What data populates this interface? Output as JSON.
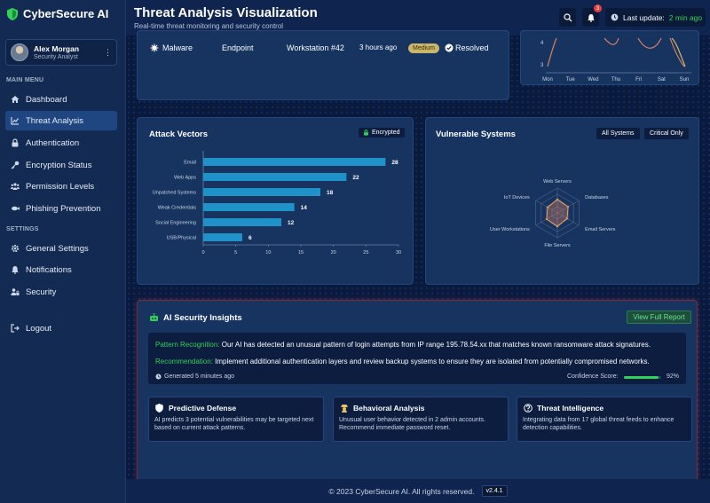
{
  "brand": {
    "name": "CyberSecure AI",
    "icon": "shield-icon"
  },
  "user": {
    "name": "Alex Morgan",
    "role": "Security Analyst"
  },
  "sidebar": {
    "main_menu_title": "MAIN MENU",
    "main_items": [
      {
        "label": "Dashboard",
        "icon": "home-icon"
      },
      {
        "label": "Threat Analysis",
        "icon": "chart-line-icon",
        "active": true
      },
      {
        "label": "Authentication",
        "icon": "lock-icon"
      },
      {
        "label": "Encryption Status",
        "icon": "key-icon"
      },
      {
        "label": "Permission Levels",
        "icon": "users-icon"
      },
      {
        "label": "Phishing Prevention",
        "icon": "fish-icon"
      }
    ],
    "settings_title": "SETTINGS",
    "settings_items": [
      {
        "label": "General Settings",
        "icon": "gear-icon"
      },
      {
        "label": "Notifications",
        "icon": "bell-icon"
      },
      {
        "label": "Security",
        "icon": "user-lock-icon"
      }
    ],
    "logout_label": "Logout"
  },
  "header": {
    "title": "Threat Analysis Visualization",
    "subtitle": "Real-time threat monitoring and security control",
    "notification_count": "3",
    "last_update_label": "Last update:",
    "last_update_value": "2 min ago"
  },
  "threat_row": {
    "type": "Malware",
    "vector": "Endpoint",
    "system": "Workstation #42",
    "time": "3 hours ago",
    "severity": "Medium",
    "status": "Resolved"
  },
  "weekly_chart": {
    "y_tick_top": "4",
    "y_tick_bottom": "3",
    "days": [
      "Mon",
      "Tue",
      "Wed",
      "Thu",
      "Fri",
      "Sat",
      "Sun"
    ]
  },
  "attack_vectors": {
    "title": "Attack Vectors",
    "badge": "Encrypted"
  },
  "vulnerable": {
    "title": "Vulnerable Systems",
    "btn_all": "All Systems",
    "btn_critical": "Critical Only",
    "axes": [
      "Web Servers",
      "Databases",
      "Email Servers",
      "File Servers",
      "User Workstations",
      "IoT Devices"
    ]
  },
  "chart_data": [
    {
      "type": "bar",
      "title": "Attack Vectors",
      "orientation": "horizontal",
      "categories": [
        "Email",
        "Web Apps",
        "Unpatched Systems",
        "Weak Credentials",
        "Social Engineering",
        "USB/Physical"
      ],
      "values": [
        28,
        22,
        18,
        14,
        12,
        6
      ],
      "xlim": [
        0,
        30
      ],
      "xticks": [
        0,
        5,
        10,
        15,
        20,
        25,
        30
      ],
      "color": "#1f93c9"
    }
  ],
  "insights": {
    "title": "AI Security Insights",
    "view_button": "View Full Report",
    "pattern_label": "Pattern Recognition:",
    "pattern_text": "Our AI has detected an unusual pattern of login attempts from IP range 195.78.54.xx that matches known ransomware attack signatures.",
    "recommendation_label": "Recommendation:",
    "recommendation_text": "Implement additional authentication layers and review backup systems to ensure they are isolated from potentially compromised networks.",
    "generated": "Generated 5 minutes ago",
    "confidence_label": "Confidence Score:",
    "confidence_value": "92%",
    "confidence_fraction": 0.92,
    "cards": [
      {
        "title": "Predictive Defense",
        "text": "AI predicts 3 potential vulnerabilities may be targeted next based on current attack patterns.",
        "icon": "shield-icon"
      },
      {
        "title": "Behavioral Analysis",
        "text": "Unusual user behavior detected in 2 admin accounts. Recommend immediate password reset.",
        "icon": "user-secret-icon"
      },
      {
        "title": "Threat Intelligence",
        "text": "Integrating data from 17 global threat feeds to enhance detection capabilities.",
        "icon": "question-circle-icon"
      }
    ]
  },
  "footer": {
    "copyright": "© 2023 CyberSecure AI. All rights reserved.",
    "version": "v2.4.1"
  },
  "colors": {
    "accent": "#1f93c9",
    "active_nav": "#1f4680",
    "green": "#34d058",
    "alert_border": "#7a2a3a"
  }
}
